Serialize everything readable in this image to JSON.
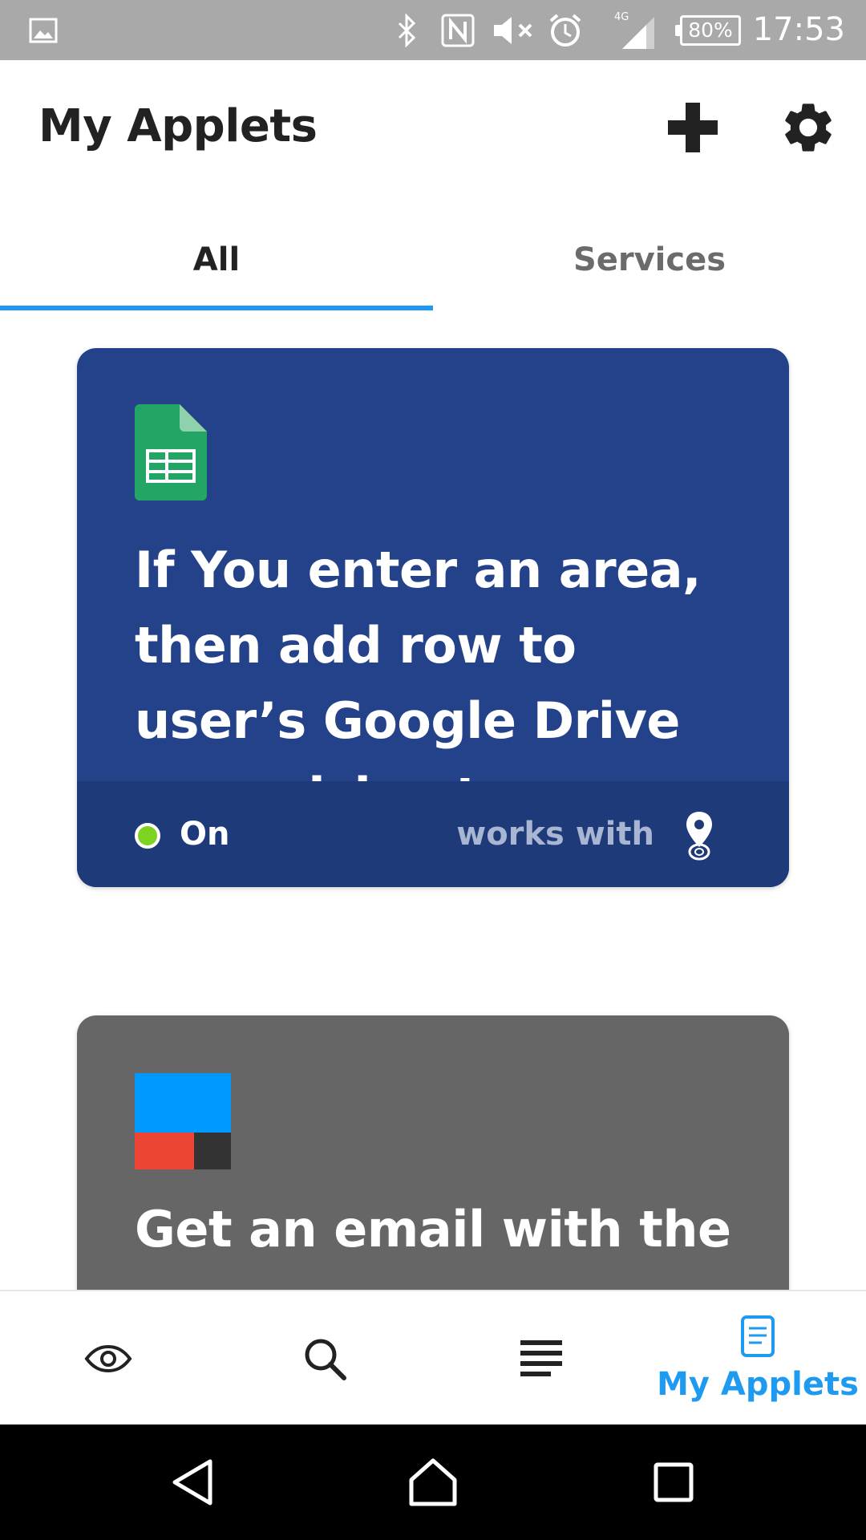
{
  "status_bar": {
    "time": "17:53",
    "battery": "80%",
    "network": "4G",
    "icons": [
      "gallery-icon",
      "bluetooth-icon",
      "nfc-icon",
      "mute-icon",
      "alarm-icon",
      "signal-icon",
      "battery-icon"
    ]
  },
  "header": {
    "title": "My Applets",
    "actions": [
      "add-icon",
      "settings-icon"
    ]
  },
  "tabs": [
    {
      "label": "All",
      "selected": true
    },
    {
      "label": "Services",
      "selected": false
    }
  ],
  "colors": {
    "accent": "#1e9bf0",
    "card1_bg": "#24428a",
    "card1_footer": "#1f3a78",
    "card2_bg": "#666666",
    "status_on": "#7ed321",
    "sheets_green": "#23a566"
  },
  "applets": [
    {
      "title": "If You enter an area, then add row to user’s Google Drive spreadsheet",
      "service_icon": "google-sheets-icon",
      "status": "On",
      "works_with_label": "works with",
      "works_with_icon": "location-icon"
    },
    {
      "title": "Get an email with the",
      "service_icon": "ifttt-service-icon"
    }
  ],
  "bottom_nav": {
    "items": [
      {
        "icon": "eye-icon",
        "label": ""
      },
      {
        "icon": "search-icon",
        "label": ""
      },
      {
        "icon": "activity-icon",
        "label": ""
      },
      {
        "icon": "my-applets-icon",
        "label": "My Applets",
        "selected": true
      }
    ]
  },
  "system_nav": [
    "back-icon",
    "home-icon",
    "recents-icon"
  ]
}
